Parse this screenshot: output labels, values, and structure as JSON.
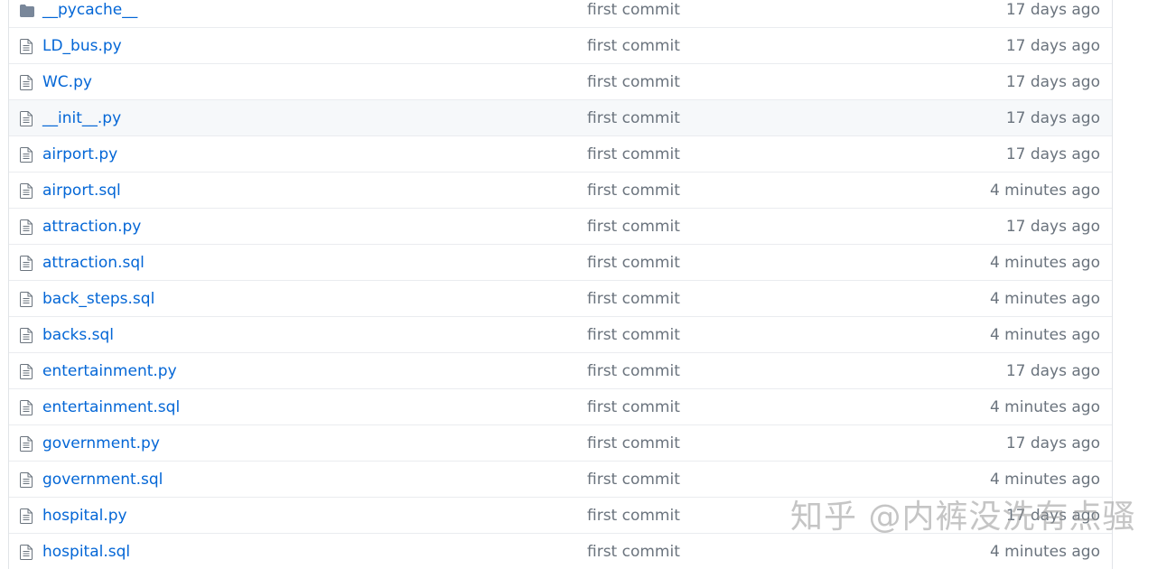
{
  "files": [
    {
      "name": "__pycache__",
      "type": "folder",
      "message": "first commit",
      "age": "17 days ago"
    },
    {
      "name": "LD_bus.py",
      "type": "file",
      "message": "first commit",
      "age": "17 days ago"
    },
    {
      "name": "WC.py",
      "type": "file",
      "message": "first commit",
      "age": "17 days ago"
    },
    {
      "name": "__init__.py",
      "type": "file",
      "message": "first commit",
      "age": "17 days ago",
      "highlighted": true
    },
    {
      "name": "airport.py",
      "type": "file",
      "message": "first commit",
      "age": "17 days ago"
    },
    {
      "name": "airport.sql",
      "type": "file",
      "message": "first commit",
      "age": "4 minutes ago"
    },
    {
      "name": "attraction.py",
      "type": "file",
      "message": "first commit",
      "age": "17 days ago"
    },
    {
      "name": "attraction.sql",
      "type": "file",
      "message": "first commit",
      "age": "4 minutes ago"
    },
    {
      "name": "back_steps.sql",
      "type": "file",
      "message": "first commit",
      "age": "4 minutes ago"
    },
    {
      "name": "backs.sql",
      "type": "file",
      "message": "first commit",
      "age": "4 minutes ago"
    },
    {
      "name": "entertainment.py",
      "type": "file",
      "message": "first commit",
      "age": "17 days ago"
    },
    {
      "name": "entertainment.sql",
      "type": "file",
      "message": "first commit",
      "age": "4 minutes ago"
    },
    {
      "name": "government.py",
      "type": "file",
      "message": "first commit",
      "age": "17 days ago"
    },
    {
      "name": "government.sql",
      "type": "file",
      "message": "first commit",
      "age": "4 minutes ago"
    },
    {
      "name": "hospital.py",
      "type": "file",
      "message": "first commit",
      "age": "17 days ago"
    },
    {
      "name": "hospital.sql",
      "type": "file",
      "message": "first commit",
      "age": "4 minutes ago"
    }
  ],
  "watermark": "知乎 @内裤没洗有点骚",
  "colors": {
    "link": "#0366d6",
    "muted": "#6a737d",
    "icon": "#6a737d",
    "row_highlight": "#f6f8fa",
    "border": "#eaecef"
  },
  "icons": {
    "folder": "folder-icon",
    "file": "file-icon"
  }
}
